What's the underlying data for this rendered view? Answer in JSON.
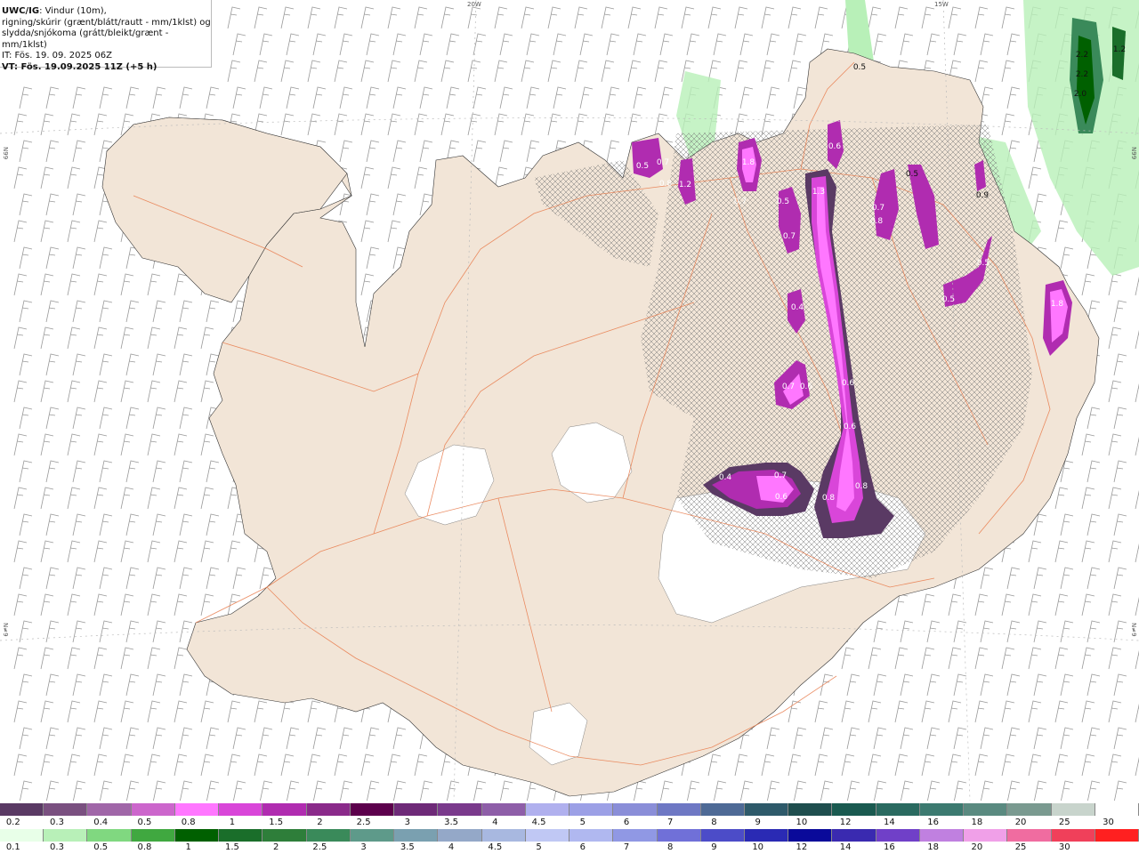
{
  "header": {
    "code": "UWC/IG",
    "line1": ": Vindur (10m),",
    "line2": "rigning/skúrir (grænt/blátt/rautt - mm/1klst) og",
    "line3": "slydda/snjókoma (grátt/bleikt/grænt - mm/1klst)",
    "line4": "IT: Fös. 19. 09. 2025 06Z",
    "line5": "VT: Fös. 19.09.2025 11Z (+5 h)"
  },
  "coords": {
    "top_left": "20W",
    "top_right": "15W",
    "left_upper": "N99",
    "left_lower": "N≠9",
    "right_upper": "N99",
    "right_lower": "N≠9"
  },
  "map_labels": [
    {
      "text": "0.5",
      "color": "#111"
    },
    {
      "text": "0.7",
      "color": "#fff"
    },
    {
      "text": "0.8",
      "color": "#fff"
    },
    {
      "text": "1.2",
      "color": "#fff"
    },
    {
      "text": "1.8",
      "color": "#fff"
    },
    {
      "text": "0.5",
      "color": "#fff"
    },
    {
      "text": "0.7",
      "color": "#fff"
    },
    {
      "text": "1.3",
      "color": "#fff"
    },
    {
      "text": "0.5",
      "color": "#fff"
    },
    {
      "text": "0.7",
      "color": "#fff"
    },
    {
      "text": "0.6",
      "color": "#fff"
    },
    {
      "text": "0.8",
      "color": "#fff"
    },
    {
      "text": "0.9",
      "color": "#111"
    },
    {
      "text": "0.5",
      "color": "#fff"
    },
    {
      "text": "0.5",
      "color": "#fff"
    },
    {
      "text": "1.8",
      "color": "#fff"
    },
    {
      "text": "0.4",
      "color": "#fff"
    },
    {
      "text": "0.7",
      "color": "#fff"
    },
    {
      "text": "0.6",
      "color": "#fff"
    },
    {
      "text": "0.6",
      "color": "#fff"
    },
    {
      "text": "0.6",
      "color": "#fff"
    },
    {
      "text": "0.4",
      "color": "#fff"
    },
    {
      "text": "0.7",
      "color": "#fff"
    },
    {
      "text": "0.6",
      "color": "#fff"
    },
    {
      "text": "0.8",
      "color": "#fff"
    },
    {
      "text": "0.8",
      "color": "#fff"
    },
    {
      "text": "2.2",
      "color": "#111"
    },
    {
      "text": "2.2",
      "color": "#111"
    },
    {
      "text": "2.0",
      "color": "#111"
    },
    {
      "text": "1.2",
      "color": "#111"
    },
    {
      "text": "0.5",
      "color": "#111"
    },
    {
      "text": "0.7",
      "color": "#fff"
    }
  ],
  "legend": {
    "snow_colors": [
      "#5a3a64",
      "#7a5080",
      "#a066a8",
      "#cc66cc",
      "#ff77ff",
      "#d946d9",
      "#b02cb0",
      "#8a2a8a",
      "#5c004c",
      "#6e2a78",
      "#7a3a8c",
      "#8e5ea8",
      "#b0b0ee",
      "#9ca0e6",
      "#8a8ed8",
      "#6e78c4",
      "#4e6a96",
      "#2e5a6a",
      "#1f4e4e",
      "#1a5a50",
      "#2a6a60",
      "#3c7a70",
      "#5a8a80",
      "#7a9a90",
      "#c8d4cc",
      "#ffffff"
    ],
    "snow_labels": [
      "0.2",
      "0.3",
      "0.4",
      "0.5",
      "0.8",
      "1",
      "1.5",
      "2",
      "2.5",
      "3",
      "3.5",
      "4",
      "4.5",
      "5",
      "6",
      "7",
      "8",
      "9",
      "10",
      "12",
      "14",
      "16",
      "18",
      "20",
      "25",
      "30"
    ],
    "rain_colors": [
      "#e8ffe8",
      "#b8f0b8",
      "#80d880",
      "#40a840",
      "#006000",
      "#1a6e2a",
      "#2e7e3a",
      "#3a8a5a",
      "#5e9a8a",
      "#7aa0b0",
      "#94a8c8",
      "#a8b8e0",
      "#c0c8f4",
      "#b0b8f0",
      "#9098e4",
      "#7070d8",
      "#4c4cc8",
      "#2a2ab4",
      "#0a0a9a",
      "#3a2ab0",
      "#7040c8",
      "#c080e0",
      "#f0a0e8",
      "#f06ca0",
      "#f0405a",
      "#ff2020"
    ],
    "rain_labels": [
      "0.1",
      "0.3",
      "0.5",
      "0.8",
      "1",
      "1.5",
      "2",
      "2.5",
      "3",
      "3.5",
      "4",
      "4.5",
      "5",
      "6",
      "7",
      "8",
      "9",
      "10",
      "12",
      "14",
      "16",
      "18",
      "20",
      "25",
      "30"
    ]
  }
}
